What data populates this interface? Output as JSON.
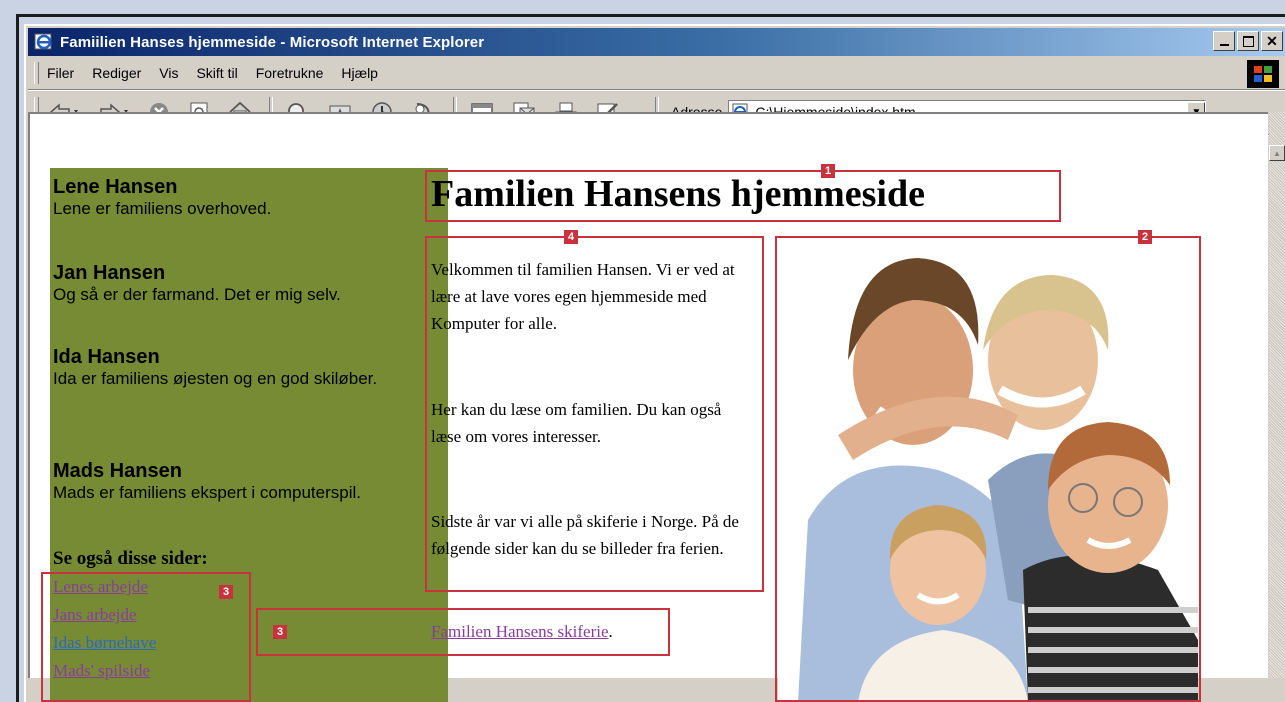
{
  "window": {
    "title": "Famiilien Hanses hjemmeside - Microsoft Internet Explorer"
  },
  "menu": {
    "items": [
      "Filer",
      "Rediger",
      "Vis",
      "Skift til",
      "Foretrukne",
      "Hjælp"
    ]
  },
  "address": {
    "label": "Adresse",
    "value": "C:\\Hjemmeside\\index.htm"
  },
  "sidebar": {
    "persons": [
      {
        "name": "Lene Hansen",
        "desc": "Lene er familiens overhoved."
      },
      {
        "name": "Jan Hansen",
        "desc": "Og så er der farmand. Det er mig selv."
      },
      {
        "name": "Ida Hansen",
        "desc": "Ida er familiens øjesten og en god skiløber."
      },
      {
        "name": "Mads Hansen",
        "desc": "Mads er familiens ekspert i computerspil."
      }
    ],
    "see_also": "Se også disse sider:",
    "links": [
      "Lenes arbejde",
      "Jans arbejde",
      "Idas børnehave",
      "Mads' spilside"
    ]
  },
  "main": {
    "heading": "Familien Hansens hjemmeside",
    "paragraphs": [
      "Velkommen til familien Hansen. Vi er ved at lære at lave vores egen hjemmeside med Komputer for alle.",
      "Her kan du læse om familien. Du kan også læse om vores interesser.",
      "Sidste år var vi alle på skiferie i Norge. På de følgende sider kan du se billeder fra ferien."
    ],
    "ski_link": "Familien Hansens skiferie",
    "ski_suffix": "."
  },
  "callouts": {
    "heading": "1",
    "photo": "2",
    "links_left": "3",
    "links_mid": "3",
    "text": "4"
  },
  "colors": {
    "sidebar_bg": "#768b34",
    "callout": "#c8323c",
    "visited_link": "#8a3c9e",
    "link": "#2a6abf"
  },
  "icons": [
    "back-arrow-icon",
    "forward-arrow-icon",
    "stop-icon",
    "refresh-icon",
    "home-icon",
    "search-icon",
    "favorites-icon",
    "history-icon",
    "channels-icon",
    "fullscreen-icon",
    "mail-icon",
    "print-icon",
    "edit-icon",
    "ie-page-icon",
    "windows-logo-icon"
  ]
}
